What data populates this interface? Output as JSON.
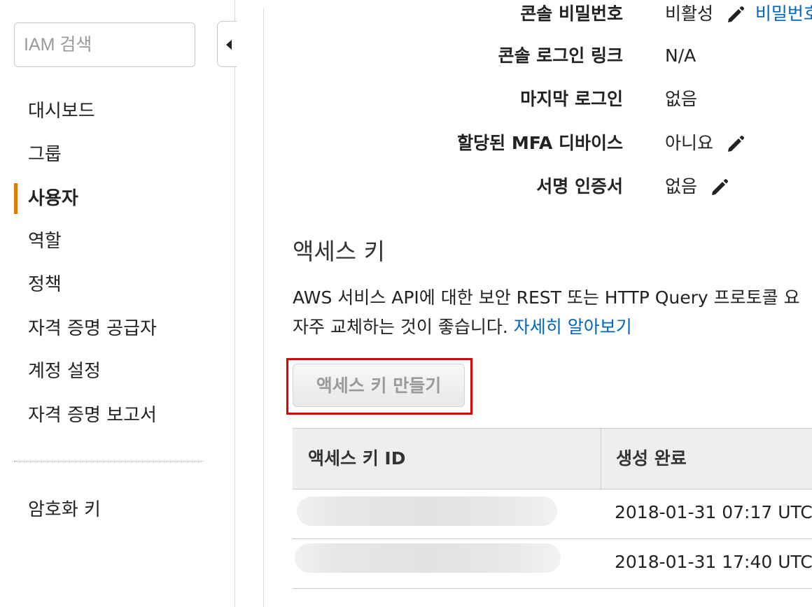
{
  "sidebar": {
    "search_placeholder": "IAM 검색",
    "items": [
      {
        "label": "대시보드",
        "active": false
      },
      {
        "label": "그룹",
        "active": false
      },
      {
        "label": "사용자",
        "active": true
      },
      {
        "label": "역할",
        "active": false
      },
      {
        "label": "정책",
        "active": false
      },
      {
        "label": "자격 증명 공급자",
        "active": false
      },
      {
        "label": "계정 설정",
        "active": false
      },
      {
        "label": "자격 증명 보고서",
        "active": false
      }
    ],
    "extra_items": [
      {
        "label": "암호화 키"
      }
    ],
    "accent_color": "#e07b00"
  },
  "summary": {
    "console_password": {
      "label": "콘솔 비밀번호",
      "value": "비활성",
      "link": "비밀번호"
    },
    "console_login_link": {
      "label": "콘솔 로그인 링크",
      "value": "N/A"
    },
    "last_login": {
      "label": "마지막 로그인",
      "value": "없음"
    },
    "mfa_device": {
      "label": "할당된 MFA 디바이스",
      "value": "아니요"
    },
    "signing_certs": {
      "label": "서명 인증서",
      "value": "없음"
    }
  },
  "access_keys": {
    "title": "액세스 키",
    "desc_line1": "AWS 서비스 API에 대한 보안 REST 또는 HTTP Query 프로토콜 요",
    "desc_line2": "자주 교체하는 것이 좋습니다.",
    "learn_more": "자세히 알아보기",
    "create_button": "액세스 키 만들기",
    "table": {
      "columns": [
        "액세스 키 ID",
        "생성 완료"
      ],
      "rows": [
        {
          "id": "",
          "created": "2018-01-31 07:17 UTC"
        },
        {
          "id": "",
          "created": "2018-01-31 17:40 UTC"
        }
      ]
    }
  },
  "colors": {
    "link": "#0066c0",
    "highlight": "#e00000"
  }
}
